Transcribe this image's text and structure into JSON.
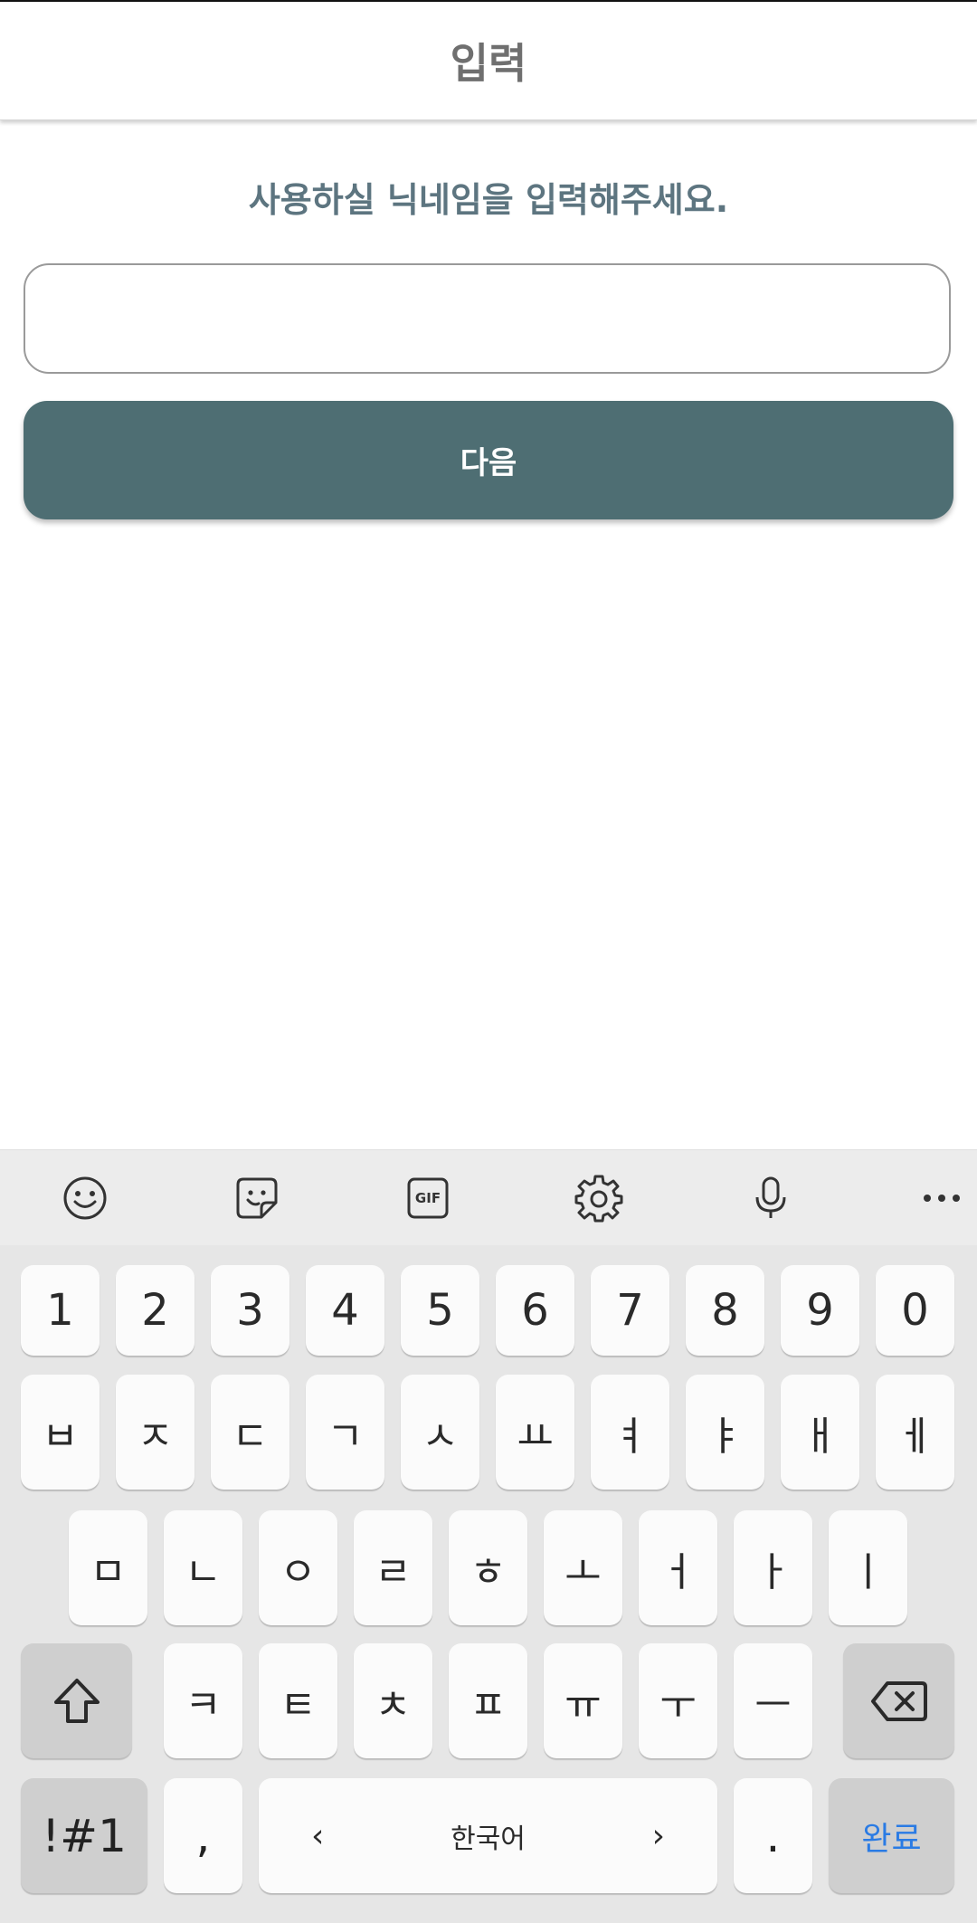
{
  "appbar": {
    "title": "입력"
  },
  "main": {
    "prompt": "사용하실 닉네임을 입력해주세요.",
    "nickname": {
      "value": "",
      "placeholder": ""
    },
    "next_label": "다음"
  },
  "keyboard": {
    "toolbar": [
      "emoji-icon",
      "sticker-icon",
      "gif-icon",
      "settings-icon",
      "microphone-icon",
      "more-icon"
    ],
    "gif_text": "GIF",
    "row_numbers": [
      "1",
      "2",
      "3",
      "4",
      "5",
      "6",
      "7",
      "8",
      "9",
      "0"
    ],
    "row1": [
      "ㅂ",
      "ㅈ",
      "ㄷ",
      "ㄱ",
      "ㅅ",
      "ㅛ",
      "ㅕ",
      "ㅑ",
      "ㅐ",
      "ㅔ"
    ],
    "row2": [
      "ㅁ",
      "ㄴ",
      "ㅇ",
      "ㄹ",
      "ㅎ",
      "ㅗ",
      "ㅓ",
      "ㅏ",
      "ㅣ"
    ],
    "row3": [
      "ㅋ",
      "ㅌ",
      "ㅊ",
      "ㅍ",
      "ㅠ",
      "ㅜ",
      "ㅡ"
    ],
    "symbols_label": "!#1",
    "comma_label": ",",
    "space_label": "한국어",
    "space_left": "‹",
    "space_right": "›",
    "period_label": ".",
    "done_label": "완료",
    "accent_color": "#2a7be4"
  }
}
